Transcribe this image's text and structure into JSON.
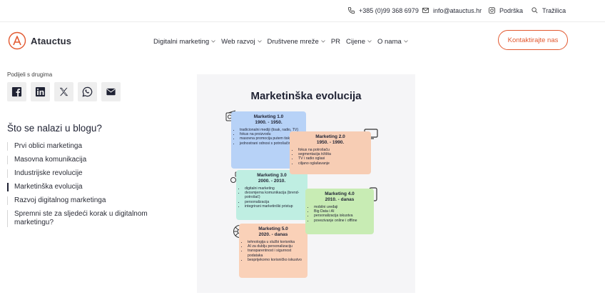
{
  "topbar": {
    "phone": "+385 (0)99 368 6979",
    "email": "info@atauctus.hr",
    "support": "Podrška",
    "search": "Tražilica"
  },
  "header": {
    "brand": "Atauctus",
    "nav": [
      {
        "label": "Digitalni marketing",
        "has_dropdown": true
      },
      {
        "label": "Web razvoj",
        "has_dropdown": true
      },
      {
        "label": "Društvene mreže",
        "has_dropdown": true
      },
      {
        "label": "PR",
        "has_dropdown": false
      },
      {
        "label": "Cijene",
        "has_dropdown": true
      },
      {
        "label": "O nama",
        "has_dropdown": true
      }
    ],
    "cta_label": "Kontaktirajte nas"
  },
  "share": {
    "label": "Podijeli s drugima",
    "icons": [
      "facebook-icon",
      "linkedin-icon",
      "x-icon",
      "whatsapp-icon",
      "mail-icon"
    ]
  },
  "toc": {
    "title": "Što se nalazi u blogu?",
    "items": [
      "Prvi oblici marketinga",
      "Masovna komunikacija",
      "Industrijske revolucije",
      "Marketinška evolucija",
      "Razvoj digitalnog marketinga",
      "Spremni ste za sljedeći korak u digitalnom marketingu?"
    ],
    "active_index": 3
  },
  "infographic": {
    "title": "Marketinška evolucija",
    "cards": [
      {
        "name": "Marketing 1.0",
        "period": "1900. - 1950.",
        "points": [
          "tradicionalni mediji (tisak, radio, TV)",
          "fokus na proizvodu",
          "masovna promocija putem tiska",
          "jednostrani odnosi s potrošačima"
        ]
      },
      {
        "name": "Marketing 2.0",
        "period": "1950. - 1990.",
        "points": [
          "fokus na potrošaču",
          "segmentacija tržišta",
          "TV i radio oglasi",
          "ciljano oglašavanje"
        ]
      },
      {
        "name": "Marketing 3.0",
        "period": "2000. - 2010.",
        "points": [
          "digitalni marketing",
          "dvosmjerna komunikacija (brend-potrošač)",
          "personalizacija",
          "integrirani marketinški pristup"
        ]
      },
      {
        "name": "Marketing 4.0",
        "period": "2010. - danas",
        "points": [
          "mobilni uređaji",
          "Big Data i AI",
          "personalizacija iskustva",
          "povezivanje online i offline"
        ]
      },
      {
        "name": "Marketing 5.0",
        "period": "2020. - danas",
        "points": [
          "tehnologija u službi korisnika",
          "AI za dublju personalizaciju",
          "transparentnost i sigurnost podataka",
          "besprijekorno korisničko iskustvo"
        ]
      }
    ]
  },
  "colors": {
    "accent": "#e2582f",
    "card1": "#b7d2f7",
    "card2": "#f7cdb4",
    "card3": "#bfeee2",
    "card4": "#c8ecb4",
    "card5": "#fad1b8"
  }
}
